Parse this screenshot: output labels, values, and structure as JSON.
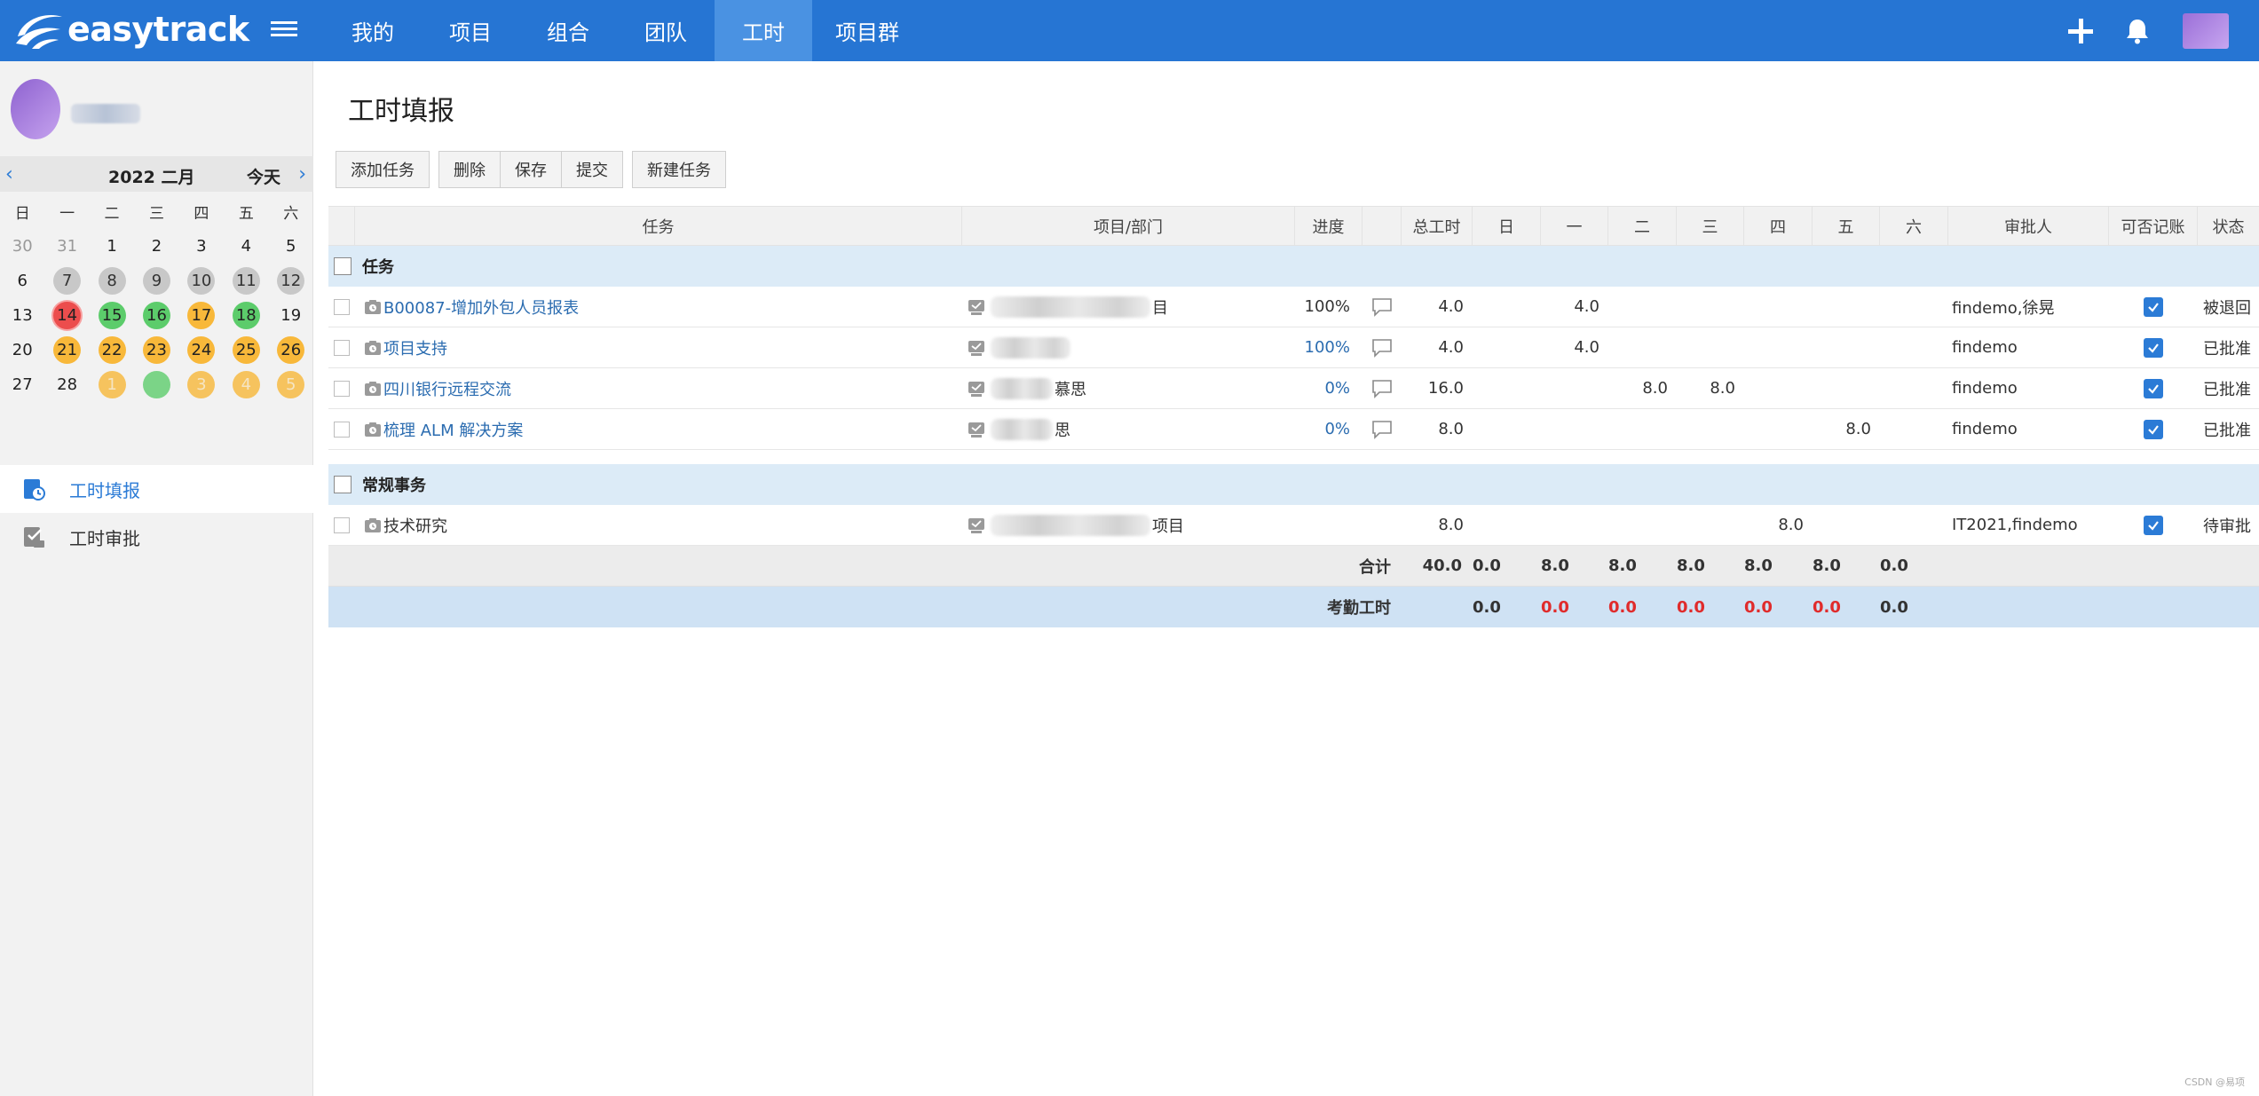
{
  "brand": {
    "name": "easytrack"
  },
  "nav": {
    "items": [
      "我的",
      "项目",
      "组合",
      "团队",
      "工时",
      "项目群"
    ],
    "active_index": 4
  },
  "calendar": {
    "year_month": "2022 二月",
    "today_label": "今天",
    "weekdays": [
      "日",
      "一",
      "二",
      "三",
      "四",
      "五",
      "六"
    ],
    "rows": [
      [
        {
          "t": "30",
          "s": "other"
        },
        {
          "t": "31",
          "s": "other"
        },
        {
          "t": "1",
          "s": ""
        },
        {
          "t": "2",
          "s": ""
        },
        {
          "t": "3",
          "s": ""
        },
        {
          "t": "4",
          "s": ""
        },
        {
          "t": "5",
          "s": ""
        }
      ],
      [
        {
          "t": "6",
          "s": ""
        },
        {
          "t": "7",
          "s": "grey"
        },
        {
          "t": "8",
          "s": "grey"
        },
        {
          "t": "9",
          "s": "grey"
        },
        {
          "t": "10",
          "s": "grey"
        },
        {
          "t": "11",
          "s": "grey"
        },
        {
          "t": "12",
          "s": "grey"
        }
      ],
      [
        {
          "t": "13",
          "s": ""
        },
        {
          "t": "14",
          "s": "red"
        },
        {
          "t": "15",
          "s": "green"
        },
        {
          "t": "16",
          "s": "green"
        },
        {
          "t": "17",
          "s": "orange"
        },
        {
          "t": "18",
          "s": "green"
        },
        {
          "t": "19",
          "s": ""
        }
      ],
      [
        {
          "t": "20",
          "s": ""
        },
        {
          "t": "21",
          "s": "orange"
        },
        {
          "t": "22",
          "s": "orange"
        },
        {
          "t": "23",
          "s": "orange"
        },
        {
          "t": "24",
          "s": "orange"
        },
        {
          "t": "25",
          "s": "orange"
        },
        {
          "t": "26",
          "s": "orange"
        }
      ],
      [
        {
          "t": "27",
          "s": ""
        },
        {
          "t": "28",
          "s": ""
        },
        {
          "t": "1",
          "s": "orange faint"
        },
        {
          "t": "",
          "s": "green faint"
        },
        {
          "t": "3",
          "s": "orange faint"
        },
        {
          "t": "4",
          "s": "orange faint"
        },
        {
          "t": "5",
          "s": "orange faint"
        }
      ]
    ]
  },
  "sidebar": {
    "items": [
      {
        "label": "工时填报",
        "active": true
      },
      {
        "label": "工时审批",
        "active": false
      }
    ]
  },
  "page": {
    "title": "工时填报"
  },
  "toolbar": {
    "add_task": "添加任务",
    "delete": "删除",
    "save": "保存",
    "submit": "提交",
    "new_task": "新建任务"
  },
  "columns": [
    "任务",
    "项目/部门",
    "进度",
    "",
    "总工时",
    "日",
    "一",
    "二",
    "三",
    "四",
    "五",
    "六",
    "审批人",
    "可否记账",
    "状态"
  ],
  "sections": [
    {
      "label": "任务",
      "rows": [
        {
          "task": "B00087-增加外包人员报表",
          "proj_suffix": "目",
          "progress": "100%",
          "progress_blue": false,
          "total": "4.0",
          "days": [
            "",
            "4.0",
            "",
            "",
            "",
            "",
            ""
          ],
          "approver": "findemo,徐晃",
          "billable": true,
          "status": "被退回",
          "link": true
        },
        {
          "task": "项目支持",
          "proj_suffix": "",
          "progress": "100%",
          "progress_blue": true,
          "total": "4.0",
          "days": [
            "",
            "4.0",
            "",
            "",
            "",
            "",
            ""
          ],
          "approver": "findemo",
          "billable": true,
          "status": "已批准",
          "link": true
        },
        {
          "task": "四川银行远程交流",
          "proj_suffix": "慕思",
          "progress": "0%",
          "progress_blue": true,
          "total": "16.0",
          "days": [
            "",
            "",
            "8.0",
            "8.0",
            "",
            "",
            ""
          ],
          "approver": "findemo",
          "billable": true,
          "status": "已批准",
          "link": true
        },
        {
          "task": "梳理 ALM 解决方案",
          "proj_suffix": "思",
          "progress": "0%",
          "progress_blue": true,
          "total": "8.0",
          "days": [
            "",
            "",
            "",
            "",
            "",
            "8.0",
            ""
          ],
          "approver": "findemo",
          "billable": true,
          "status": "已批准",
          "link": true
        }
      ]
    },
    {
      "label": "常规事务",
      "rows": [
        {
          "task": "技术研究",
          "proj_suffix": "项目",
          "progress": "",
          "progress_blue": false,
          "total": "8.0",
          "days": [
            "",
            "",
            "",
            "",
            "8.0",
            "",
            ""
          ],
          "approver": "IT2021,findemo",
          "billable": true,
          "status": "待审批",
          "link": false
        }
      ]
    }
  ],
  "totals": {
    "label": "合计",
    "total": "40.0",
    "days": [
      "0.0",
      "8.0",
      "8.0",
      "8.0",
      "8.0",
      "8.0",
      "0.0"
    ]
  },
  "attendance": {
    "label": "考勤工时",
    "days": [
      "0.0",
      "0.0",
      "0.0",
      "0.0",
      "0.0",
      "0.0",
      "0.0"
    ],
    "red_flags": [
      false,
      true,
      true,
      true,
      true,
      true,
      false
    ]
  },
  "watermark": "CSDN @易项",
  "colors": {
    "topbar": "#2675d3",
    "active_nav": "#4a92e2",
    "link": "#2b6cb0",
    "red": "#e02b2b"
  }
}
